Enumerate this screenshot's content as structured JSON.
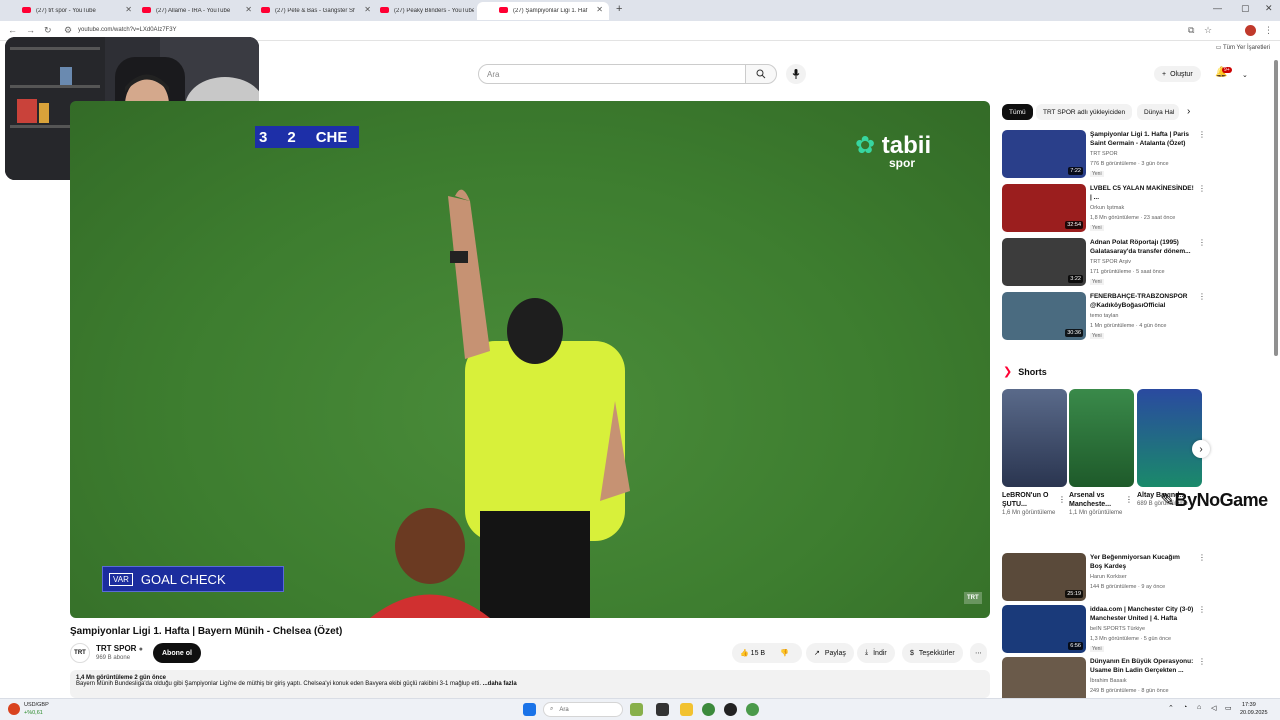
{
  "browser": {
    "tabs": [
      {
        "title": "(27) trt spor - YouTube"
      },
      {
        "title": "(27) Allame - IRA - YouTube"
      },
      {
        "title": "(27) Pete & Bas - Gangster Sh"
      },
      {
        "title": "(27) Peaky Blinders - YouTube"
      },
      {
        "title": "(27) Şampiyonlar Ligi 1. Haf"
      }
    ],
    "url": "youtube.com/watch?v=LXd0AIz7F3Y",
    "bookmarks_label": "Tüm Yer İşaretleri"
  },
  "header": {
    "search_placeholder": "Ara",
    "create_label": "Oluştur",
    "notif_badge": "9+"
  },
  "video": {
    "score_home": "3",
    "score_away": "2",
    "score_team": "CHE",
    "brand_main": "tabii",
    "brand_sub": "spor",
    "var_tag": "VAR",
    "goal_check": "GOAL CHECK",
    "watermark": "TRT",
    "title": "Şampiyonlar Ligi 1. Hafta | Bayern Münih - Chelsea (Özet)"
  },
  "channel": {
    "avatar_text": "TRT",
    "name": "TRT SPOR",
    "subs": "969 B abone",
    "subscribe_label": "Abone ol"
  },
  "actions": {
    "likes": "15 B",
    "share": "Paylaş",
    "download": "İndir",
    "thanks": "Teşekkürler"
  },
  "description": {
    "meta": "1,4 Mn görüntüleme  2 gün önce",
    "text": "Bayern Münih Bundesliga'da olduğu gibi Şampiyonlar Ligi'ne de müthiş bir giriş yaptı. Chelsea'yi konuk eden Bavyera ekibi güçlü rakibini 3-1 mağlup etti.",
    "more": "...daha fazla"
  },
  "chips": [
    "Tümü",
    "TRT SPOR adlı yükleyiciden",
    "Dünya Hal"
  ],
  "recs_top": [
    {
      "title": "Şampiyonlar Ligi 1. Hafta | Paris Saint Germain - Atalanta (Özet)",
      "channel": "TRT SPOR",
      "meta": "776 B görüntüleme · 3 gün önce",
      "badge": "Yeni",
      "dur": "7:22",
      "color": "#2a3f8a"
    },
    {
      "title": "LVBEL C5 YALAN MAKİNESİNDE! | ...",
      "channel": "Orkun Işıtmak",
      "meta": "1,8 Mn görüntüleme · 23 saat önce",
      "badge": "Yeni",
      "dur": "32:54",
      "color": "#9b1e1e"
    },
    {
      "title": "Adnan Polat Röportajı (1995) Galatasaray'da transfer dönem...",
      "channel": "TRT SPOR Arşiv",
      "meta": "171 görüntüleme · 5 saat önce",
      "badge": "Yeni",
      "dur": "3:22",
      "color": "#3c3c3c"
    },
    {
      "title": "FENERBAHÇE-TRABZONSPOR @KadıköyBoğasıOfficial",
      "channel": "temo taylan",
      "meta": "1 Mn görüntüleme · 4 gün önce",
      "badge": "Yeni",
      "dur": "30:36",
      "color": "#4a6b80"
    }
  ],
  "shorts": {
    "header": "Shorts",
    "items": [
      {
        "label": "LeBRON'un O ŞUTU...",
        "views": "1,6 Mn görüntüleme",
        "color": "#3c4a6b"
      },
      {
        "label": "Arsenal vs Mancheste...",
        "views": "1,1 Mn görüntüleme",
        "color": "#2f7a3a"
      },
      {
        "label": "Altay Bayınd...",
        "views": "689 B görüntüleme",
        "color": "#1c3a8a"
      }
    ]
  },
  "recs_bottom": [
    {
      "title": "Yer Beğenmiyorsan Kucağım Boş Kardeş",
      "channel": "Harun Korkiser",
      "meta": "144 B görüntüleme · 9 ay önce",
      "badge": "",
      "dur": "25:19",
      "color": "#5a4a3a"
    },
    {
      "title": "iddaa.com | Manchester City (3-0) Manchester United | 4. Hafta",
      "channel": "beIN SPORTS Türkiye",
      "meta": "1,3 Mn görüntüleme · 5 gün önce",
      "badge": "Yeni",
      "dur": "6:56",
      "color": "#1a3a7a"
    },
    {
      "title": "Dünyanın En Büyük Operasyonu: Usame Bin Ladin Gerçekten ...",
      "channel": "İbrahim Basaık",
      "meta": "249 B görüntüleme · 8 gün önce",
      "badge": "",
      "dur": "",
      "color": "#6a5a4a"
    }
  ],
  "overlay_brand": "ByNoGame",
  "taskbar": {
    "ticker_name": "USD/GBP",
    "ticker_change": "+%0,61",
    "search": "Ara",
    "time": "17:39",
    "date": "20.09.2025"
  }
}
